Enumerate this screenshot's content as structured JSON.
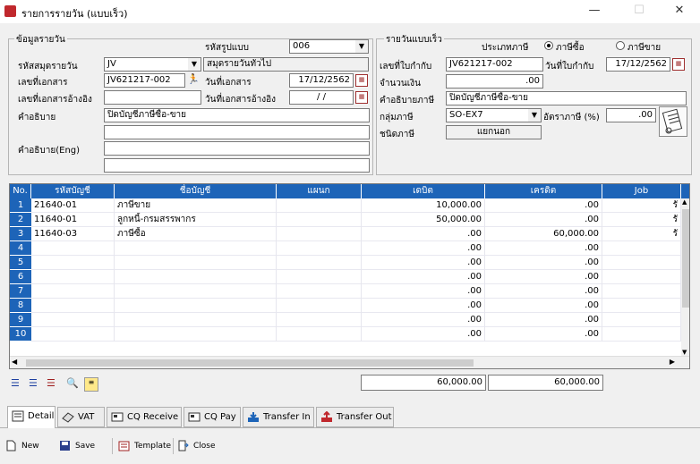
{
  "window": {
    "title": "รายการรายวัน (แบบเร็ว)",
    "minimize": "—",
    "maximize": "☐",
    "close": "✕"
  },
  "left_group": {
    "legend": "ข้อมูลรายวัน",
    "template_code_label": "รหัสรูปแบบ",
    "template_code_value": "006",
    "journal_code_label": "รหัสสมุดรายวัน",
    "journal_code_value": "JV",
    "journal_name_value": "สมุดรายวันทั่วไป",
    "doc_no_label": "เลขที่เอกสาร",
    "doc_no_value": "JV621217-002",
    "doc_date_label": "วันที่เอกสาร",
    "doc_date_value": "17/12/2562",
    "ref_doc_no_label": "เลขที่เอกสารอ้างอิง",
    "ref_doc_no_value": "",
    "ref_doc_date_label": "วันที่เอกสารอ้างอิง",
    "ref_doc_date_value": "/ /",
    "desc_label": "คำอธิบาย",
    "desc_value": "ปิดบัญชีภาษีซื้อ-ขาย",
    "desc2_value": "",
    "desc_eng_label": "คำอธิบาย(Eng)",
    "desc_eng_value": "",
    "desc_eng2_value": ""
  },
  "right_group": {
    "legend": "รายวันแบบเร็ว",
    "tax_type_label": "ประเภทภาษี",
    "radio_purchase": "ภาษีซื้อ",
    "radio_sale": "ภาษีขาย",
    "tax_invoice_no_label": "เลขที่ใบกำกับ",
    "tax_invoice_no_value": "JV621217-002",
    "tax_invoice_date_label": "วันที่ใบกำกับ",
    "tax_invoice_date_value": "17/12/2562",
    "amount_label": "จำนวนเงิน",
    "amount_value": ".00",
    "tax_desc_label": "คำอธิบายภาษี",
    "tax_desc_value": "ปิดบัญชีภาษีซื้อ-ขาย",
    "tax_group_label": "กลุ่มภาษี",
    "tax_group_value": "SO-EX7",
    "tax_rate_label": "อัตราภาษี (%)",
    "tax_rate_value": ".00",
    "tax_kind_label": "ชนิดภาษี",
    "tax_kind_value": "แยกนอก"
  },
  "grid": {
    "headers": [
      "No.",
      "รหัสบัญชี",
      "ชื่อบัญชี",
      "แผนก",
      "เดบิต",
      "เครดิต",
      "Job"
    ],
    "rows": [
      {
        "no": "1",
        "code": "21640-01",
        "name": "ภาษีขาย",
        "dept": "",
        "debit": "10,000.00",
        "credit": ".00",
        "job": "รั"
      },
      {
        "no": "2",
        "code": "11640-01",
        "name": "ลูกหนี้-กรมสรรพากร",
        "dept": "",
        "debit": "50,000.00",
        "credit": ".00",
        "job": "รั"
      },
      {
        "no": "3",
        "code": "11640-03",
        "name": "ภาษีซื้อ",
        "dept": "",
        "debit": ".00",
        "credit": "60,000.00",
        "job": "รั"
      },
      {
        "no": "4",
        "code": "",
        "name": "",
        "dept": "",
        "debit": ".00",
        "credit": ".00",
        "job": ""
      },
      {
        "no": "5",
        "code": "",
        "name": "",
        "dept": "",
        "debit": ".00",
        "credit": ".00",
        "job": ""
      },
      {
        "no": "6",
        "code": "",
        "name": "",
        "dept": "",
        "debit": ".00",
        "credit": ".00",
        "job": ""
      },
      {
        "no": "7",
        "code": "",
        "name": "",
        "dept": "",
        "debit": ".00",
        "credit": ".00",
        "job": ""
      },
      {
        "no": "8",
        "code": "",
        "name": "",
        "dept": "",
        "debit": ".00",
        "credit": ".00",
        "job": ""
      },
      {
        "no": "9",
        "code": "",
        "name": "",
        "dept": "",
        "debit": ".00",
        "credit": ".00",
        "job": ""
      },
      {
        "no": "10",
        "code": "",
        "name": "",
        "dept": "",
        "debit": ".00",
        "credit": ".00",
        "job": ""
      }
    ],
    "total_debit": "60,000.00",
    "total_credit": "60,000.00"
  },
  "tabs": [
    "Detail",
    "VAT",
    "CQ Receive",
    "CQ Pay",
    "Transfer In",
    "Transfer Out"
  ],
  "toolbar": {
    "new": "New",
    "save": "Save",
    "template": "Template",
    "close": "Close"
  },
  "colors": {
    "grid_header": "#1d64b8",
    "app_icon": "#c0282d"
  }
}
